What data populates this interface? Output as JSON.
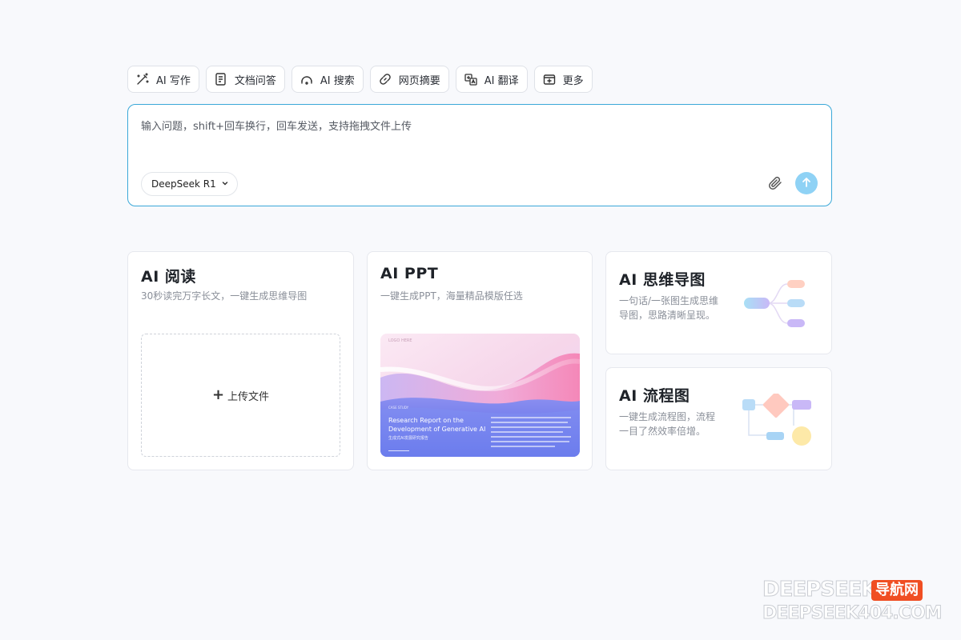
{
  "toolbar": {
    "items": [
      {
        "label": "AI 写作",
        "icon": "magic-wand-icon"
      },
      {
        "label": "文档问答",
        "icon": "document-icon"
      },
      {
        "label": "AI 搜索",
        "icon": "search-icon"
      },
      {
        "label": "网页摘要",
        "icon": "link-icon"
      },
      {
        "label": "AI 翻译",
        "icon": "translate-icon"
      },
      {
        "label": "更多",
        "icon": "more-icon"
      }
    ]
  },
  "input": {
    "placeholder": "输入问题，shift+回车换行，回车发送，支持拖拽文件上传",
    "model": "DeepSeek R1",
    "accent_color": "#3aa8d8",
    "send_color": "#8fd2f5"
  },
  "cards": {
    "reading": {
      "title": "AI 阅读",
      "desc": "30秒读完万字长文，一键生成思维导图",
      "upload_label": "上传文件"
    },
    "ppt": {
      "title": "AI PPT",
      "desc": "一键生成PPT，海量精品模版任选",
      "preview_tag": "LOGO HERE",
      "preview_sub": "CASE STUDY",
      "preview_heading": "Research Report on the Development of Generative AI",
      "preview_cn": "生成式AI发展研究报告"
    },
    "mindmap": {
      "title": "AI 思维导图",
      "desc": "一句话/一张图生成思维导图，思路清晰呈现。"
    },
    "flowchart": {
      "title": "AI 流程图",
      "desc": "一键生成流程图，流程一目了然效率倍增。"
    }
  },
  "watermark": {
    "line1": "DEEPSEEK",
    "badge": "导航网",
    "line2": "DEEPSEEK404.COM",
    "badge_color": "#f04e23"
  }
}
